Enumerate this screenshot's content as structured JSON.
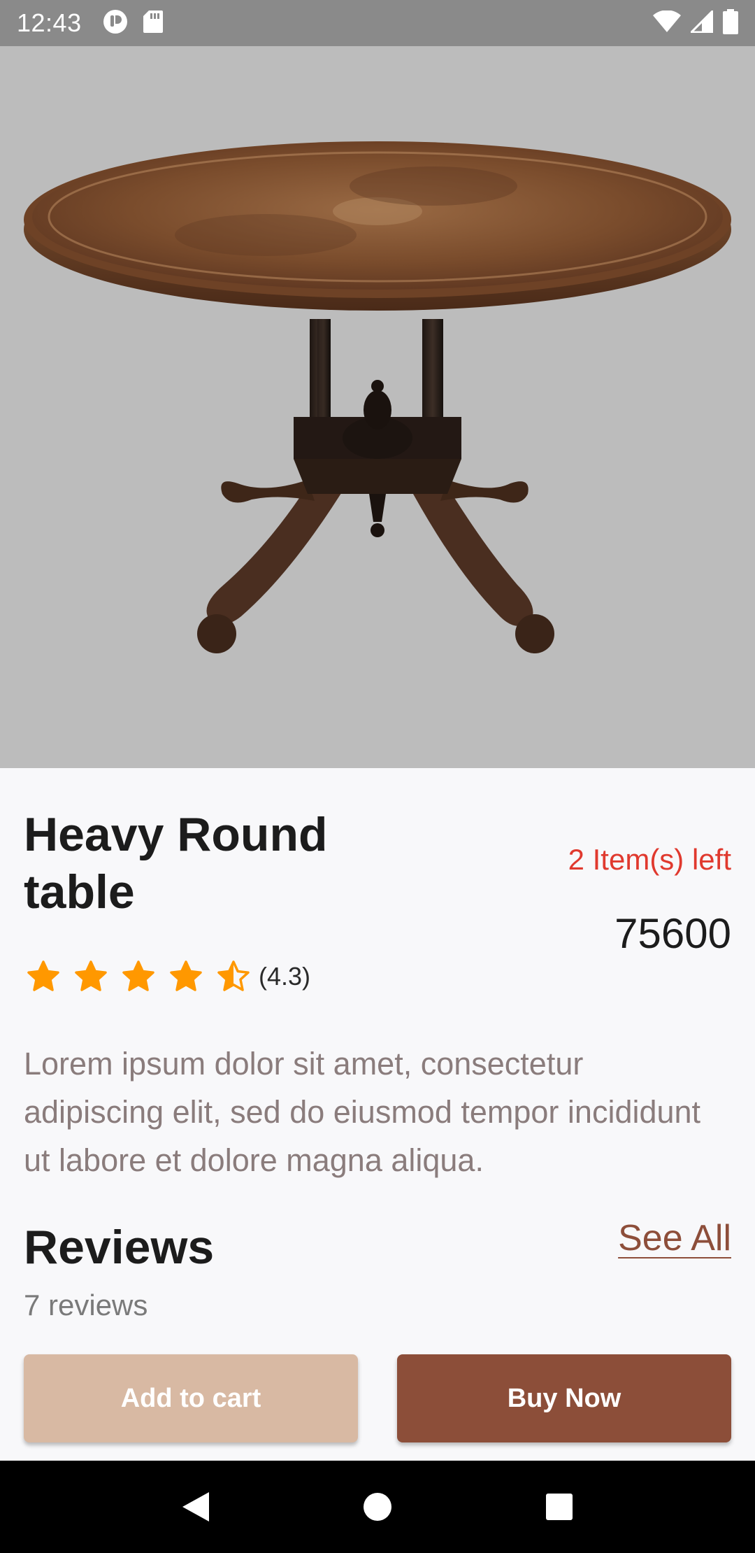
{
  "status_bar": {
    "time": "12:43",
    "left_icons": [
      "app-notification-icon",
      "sd-card-icon"
    ],
    "right_icons": [
      "wifi-icon",
      "cell-signal-icon",
      "battery-icon"
    ]
  },
  "product": {
    "image_name": "heavy-round-table-image",
    "title": "Heavy Round table",
    "stock_label": "2 Item(s) left",
    "price": "75600",
    "rating": {
      "value": 4.3,
      "label": "(4.3)",
      "max": 5,
      "star_color": "#ff9800"
    },
    "description": "Lorem ipsum dolor sit amet, consectetur adipiscing elit, sed do eiusmod tempor incididunt ut labore et dolore magna aliqua."
  },
  "reviews": {
    "title": "Reviews",
    "count_label": "7 reviews",
    "see_all_label": "See All"
  },
  "actions": {
    "add_to_cart_label": "Add to cart",
    "buy_now_label": "Buy Now"
  },
  "colors": {
    "accent": "#8c4e39",
    "accent_light": "#d8b9a3",
    "stock_warning": "#e0392e"
  },
  "nav_bar": {
    "icons": [
      "back-icon",
      "home-icon",
      "recents-icon"
    ]
  }
}
